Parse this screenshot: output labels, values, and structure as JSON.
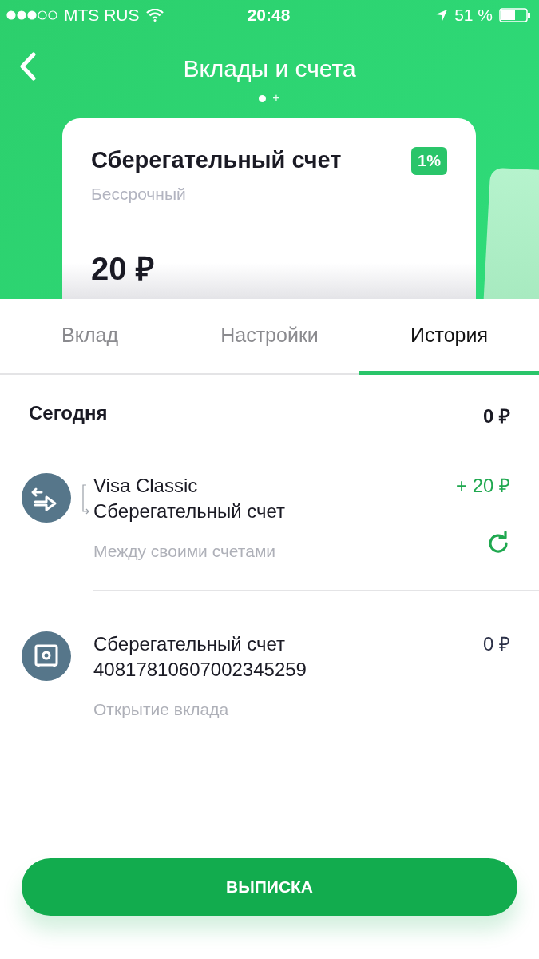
{
  "status_bar": {
    "carrier": "MTS RUS",
    "time": "20:48",
    "battery": "51 %"
  },
  "header": {
    "title": "Вклады и счета",
    "page_add": "+"
  },
  "card": {
    "title": "Сберегательный счет",
    "subtitle": "Бессрочный",
    "rate": "1%",
    "balance": "20 ₽"
  },
  "tabs": [
    {
      "label": "Вклад",
      "selected": false
    },
    {
      "label": "Настройки",
      "selected": false
    },
    {
      "label": "История",
      "selected": true
    }
  ],
  "day": {
    "label": "Сегодня",
    "total": "0 ₽"
  },
  "transactions": [
    {
      "kind": "transfer",
      "lines": [
        "Visa Classic",
        "Сберегательный счет"
      ],
      "amount": "+ 20 ₽",
      "positive": true,
      "description": "Между своими счетами",
      "repeat": true
    },
    {
      "kind": "opening",
      "lines": [
        "Сберегательный счет",
        "40817810607002345259"
      ],
      "amount": "0 ₽",
      "positive": false,
      "description": "Открытие вклада",
      "repeat": false
    }
  ],
  "button": "ВЫПИСКА"
}
